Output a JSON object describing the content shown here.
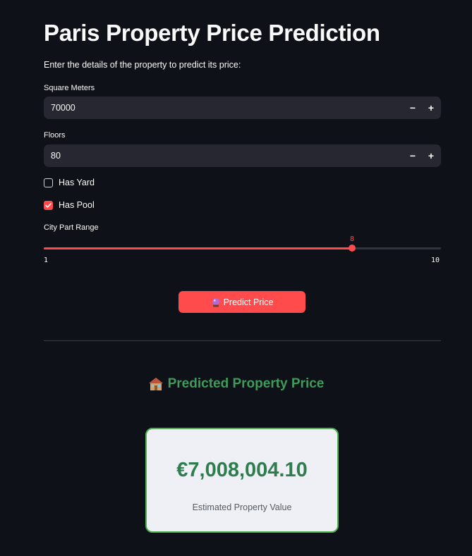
{
  "title": "Paris Property Price Prediction",
  "intro": "Enter the details of the property to predict its price:",
  "square_meters": {
    "label": "Square Meters",
    "value": "70000",
    "minus": "−",
    "plus": "+"
  },
  "floors": {
    "label": "Floors",
    "value": "80",
    "minus": "−",
    "plus": "+"
  },
  "has_yard": {
    "label": "Has Yard",
    "checked": false
  },
  "has_pool": {
    "label": "Has Pool",
    "checked": true
  },
  "city_part": {
    "label": "City Part Range",
    "value": "8",
    "min": "1",
    "max": "10"
  },
  "predict_button": {
    "label": "Predict Price",
    "icon": "crystal-ball-icon"
  },
  "result": {
    "title": "Predicted Property Price",
    "title_icon": "house-icon",
    "price": "€7,008,004.10",
    "caption": "Estimated Property Value"
  },
  "colors": {
    "accent": "#ff4b4b",
    "success": "#3f9b5a",
    "background": "#0e1117",
    "input_bg": "#262730"
  }
}
